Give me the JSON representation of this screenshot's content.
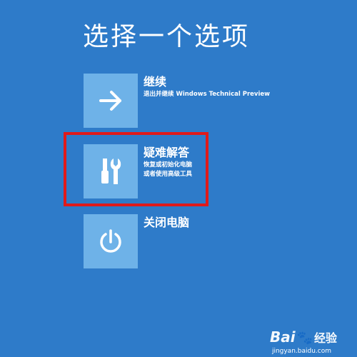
{
  "page_title": "选择一个选项",
  "options": [
    {
      "title": "继续",
      "description": "退出并继续 Windows Technical Preview",
      "icon": "arrow-right-icon"
    },
    {
      "title": "疑难解答",
      "description_lines": [
        "恢复或初始化电脑",
        "或者使用高级工具"
      ],
      "icon": "tools-icon"
    },
    {
      "title": "关闭电脑",
      "icon": "power-icon"
    }
  ],
  "watermark": {
    "brand": "Bai",
    "paw": "🐾",
    "cn": "经验",
    "url": "jingyan.baidu.com"
  },
  "colors": {
    "background": "#2e7bc9",
    "tile": "#6eb2e8",
    "highlight": "#e01a1a"
  }
}
